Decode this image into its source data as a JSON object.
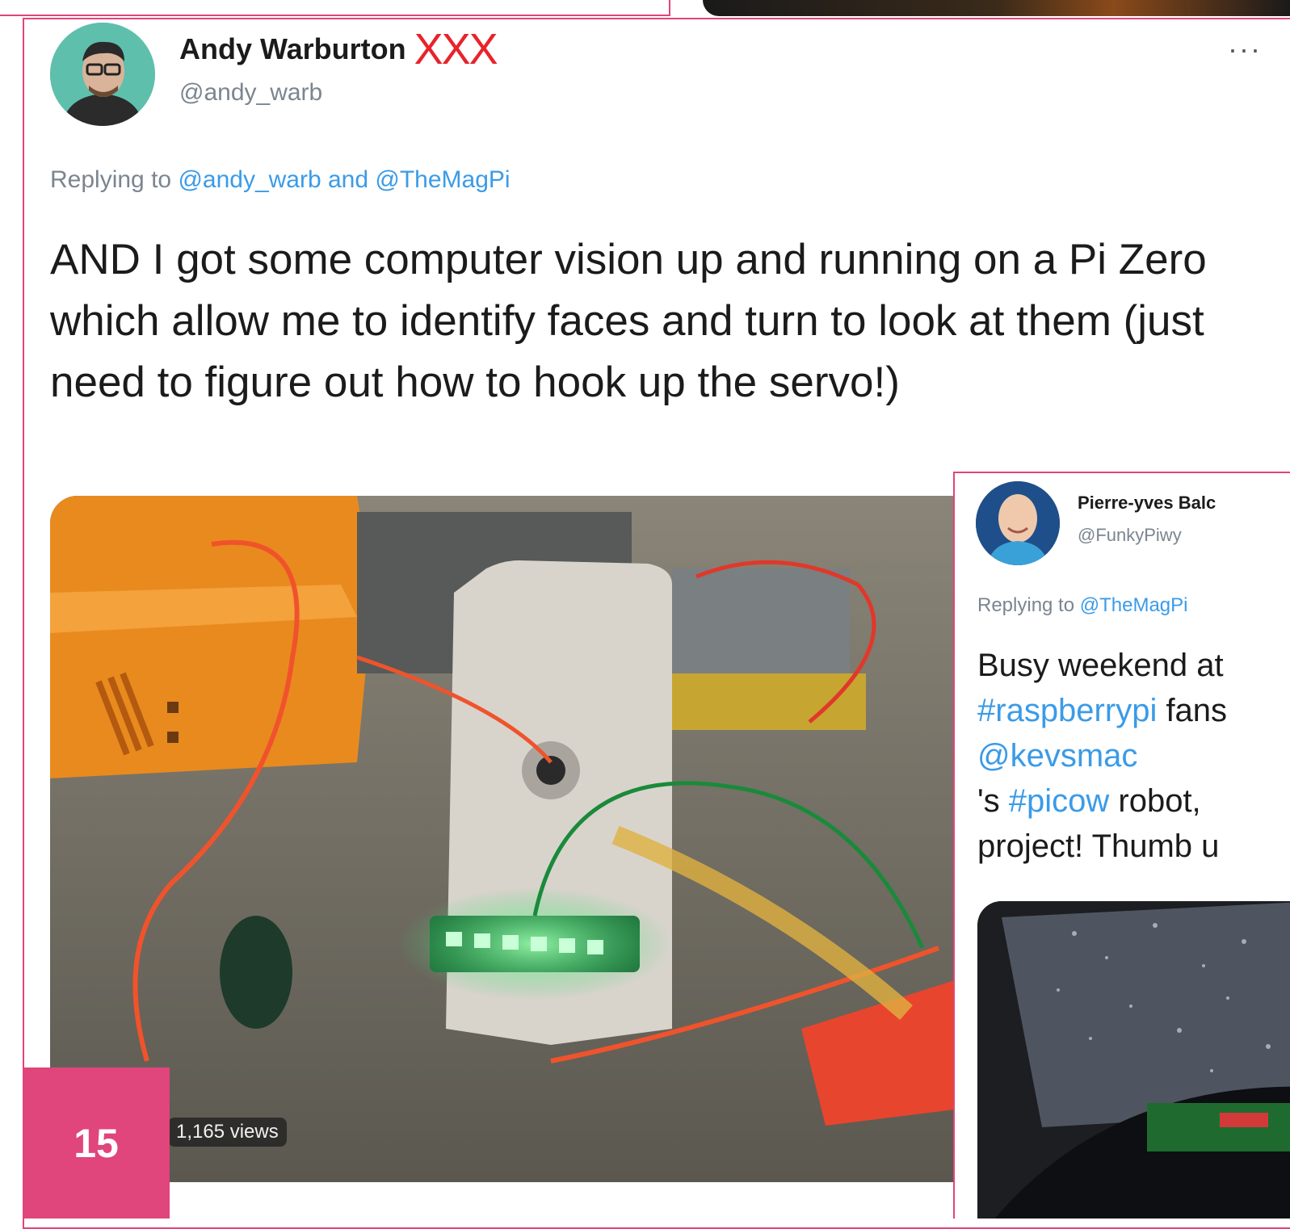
{
  "tweet_main": {
    "author_name": "Andy Warburton",
    "author_flair": "XXX",
    "author_handle": "@andy_warb",
    "more_label": "···",
    "replying_prefix": "Replying to",
    "replying_user1": "@andy_warb",
    "replying_and": "and",
    "replying_user2": "@TheMagPi",
    "body": "AND I got some computer vision up and running on a Pi Zero which allow me to identify faces and turn to look at them (just need to figure out how to hook up the servo!)",
    "views": "1,165 views"
  },
  "page_number": "15",
  "tweet_secondary": {
    "author_name": "Pierre-yves Balc",
    "author_handle": "@FunkyPiwy",
    "replying_prefix": "Replying to",
    "replying_user": "@TheMagPi",
    "line1": "Busy weekend at",
    "line2_tag": "#raspberrypi",
    "line2_text": " fans",
    "line3_mention": "@kevsmac",
    "line4_prefix": "'s ",
    "line4_tag": "#picow",
    "line4_text": " robot,",
    "line5": "project! Thumb u"
  },
  "colors": {
    "accent_pink": "#e0457b",
    "link_blue": "#3a9be8",
    "flair_red": "#e8232b"
  }
}
